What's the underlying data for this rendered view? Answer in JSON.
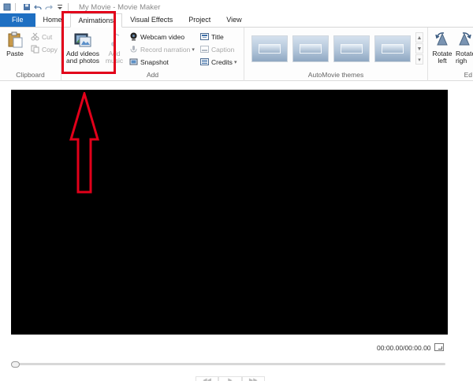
{
  "window": {
    "title": "My Movie - Movie Maker"
  },
  "tabs": [
    {
      "label": "File"
    },
    {
      "label": "Home"
    },
    {
      "label": "Animations"
    },
    {
      "label": "Visual Effects"
    },
    {
      "label": "Project"
    },
    {
      "label": "View"
    }
  ],
  "ribbon": {
    "clipboard": {
      "label": "Clipboard",
      "paste": "Paste",
      "cut": "Cut",
      "copy": "Copy"
    },
    "add": {
      "label": "Add",
      "add_videos_line1": "Add videos",
      "add_videos_line2": "and photos",
      "add_music_line1": "Add",
      "add_music_line2": "music",
      "webcam_video": "Webcam video",
      "record_narration": "Record narration",
      "snapshot": "Snapshot",
      "title": "Title",
      "caption": "Caption",
      "credits": "Credits"
    },
    "automovie": {
      "label": "AutoMovie themes",
      "theme_count": 4
    },
    "editing": {
      "label": "Ed",
      "rotate_left_line1": "Rotate",
      "rotate_left_line2": "left",
      "rotate_right_line1": "Rotate",
      "rotate_right_line2": "righ"
    }
  },
  "player": {
    "time": "00:00.00/00:00.00",
    "seek_position": 0
  },
  "colors": {
    "file_tab": "#1e6fc2",
    "annotation_red": "#e2001a",
    "preview_bg": "#000000"
  }
}
